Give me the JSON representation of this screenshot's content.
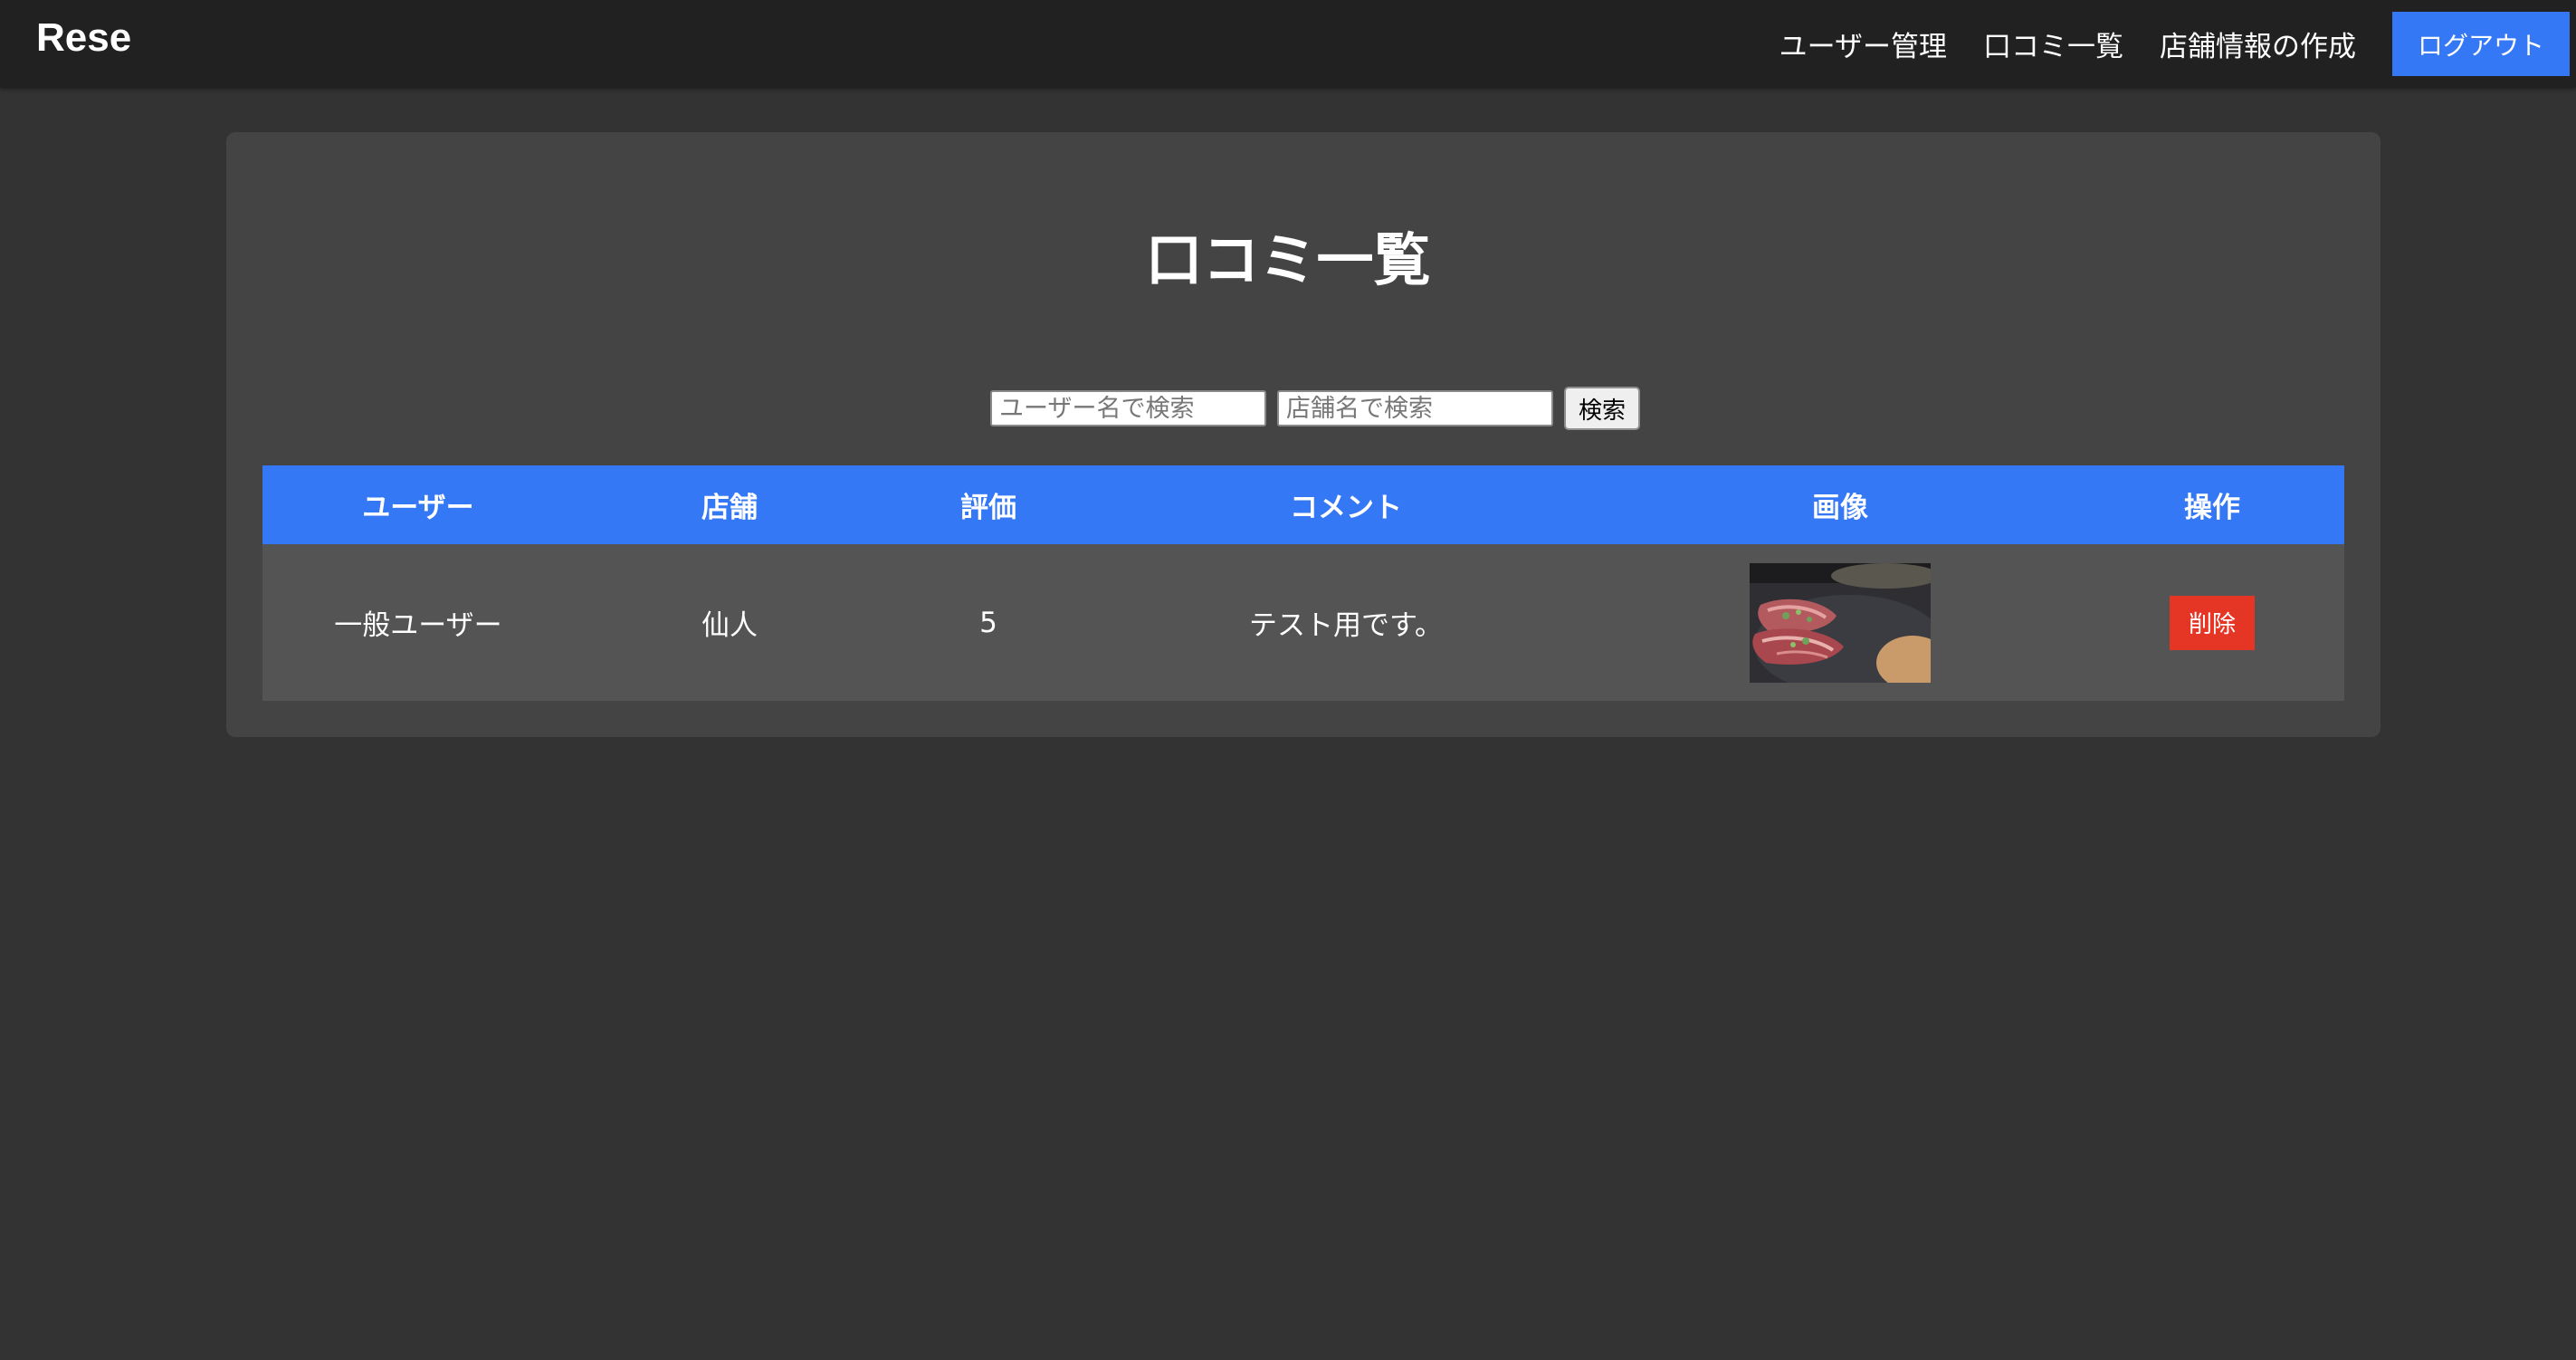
{
  "header": {
    "logo": "Rese",
    "nav": {
      "user_management": "ユーザー管理",
      "review_list": "口コミ一覧",
      "create_shop": "店舗情報の作成",
      "logout": "ログアウト"
    }
  },
  "main": {
    "title": "口コミ一覧",
    "search": {
      "user_placeholder": "ユーザー名で検索",
      "shop_placeholder": "店舗名で検索",
      "button_label": "検索"
    },
    "table": {
      "columns": [
        "ユーザー",
        "店舗",
        "評価",
        "コメント",
        "画像",
        "操作"
      ],
      "rows": [
        {
          "user": "一般ユーザー",
          "shop": "仙人",
          "rating": "5",
          "comment": "テスト用です。",
          "image_icon": "food-photo-thumbnail-icon",
          "action_label": "削除"
        }
      ]
    }
  },
  "colors": {
    "background": "#333333",
    "header": "#212121",
    "card": "#444444",
    "accent": "#3478f6",
    "row": "#545454",
    "danger": "#e53525"
  }
}
